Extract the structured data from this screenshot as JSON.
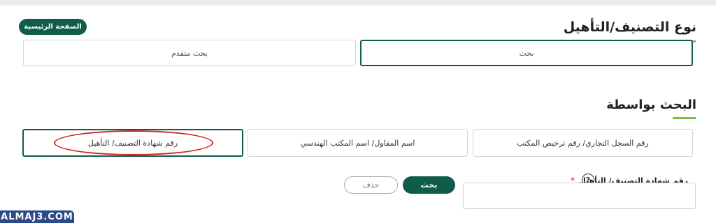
{
  "header": {
    "home_button": "الصفحة الرئيسية",
    "title": "نوع التصنيف/التأهيل"
  },
  "type_tabs": [
    {
      "label": "بحث",
      "active": true
    },
    {
      "label": "بحث متقدم",
      "active": false
    }
  ],
  "search_by": {
    "title": "البحث بواسطة",
    "tabs": [
      {
        "label": "رقم السجل التجاري/ رقم ترخيص المكتب",
        "active": false
      },
      {
        "label": "اسم المقاول/ اسم المكتب الهندسي",
        "active": false
      },
      {
        "label": "رقم شهادة التصنيف/ التأهيل",
        "active": true
      }
    ]
  },
  "form": {
    "field_label": "رقم شهادة التصنيف/ التأهيل",
    "help_icon": "?",
    "required_mark": "*",
    "input_value": "",
    "search_button": "بحث",
    "delete_button": "حذف"
  },
  "watermark": "ALMAJ3.COM",
  "colors": {
    "primary": "#0f5c4a",
    "accent_underline": "#7bbf3f",
    "annotation": "#d42323",
    "watermark_bg": "#2c4a86"
  }
}
